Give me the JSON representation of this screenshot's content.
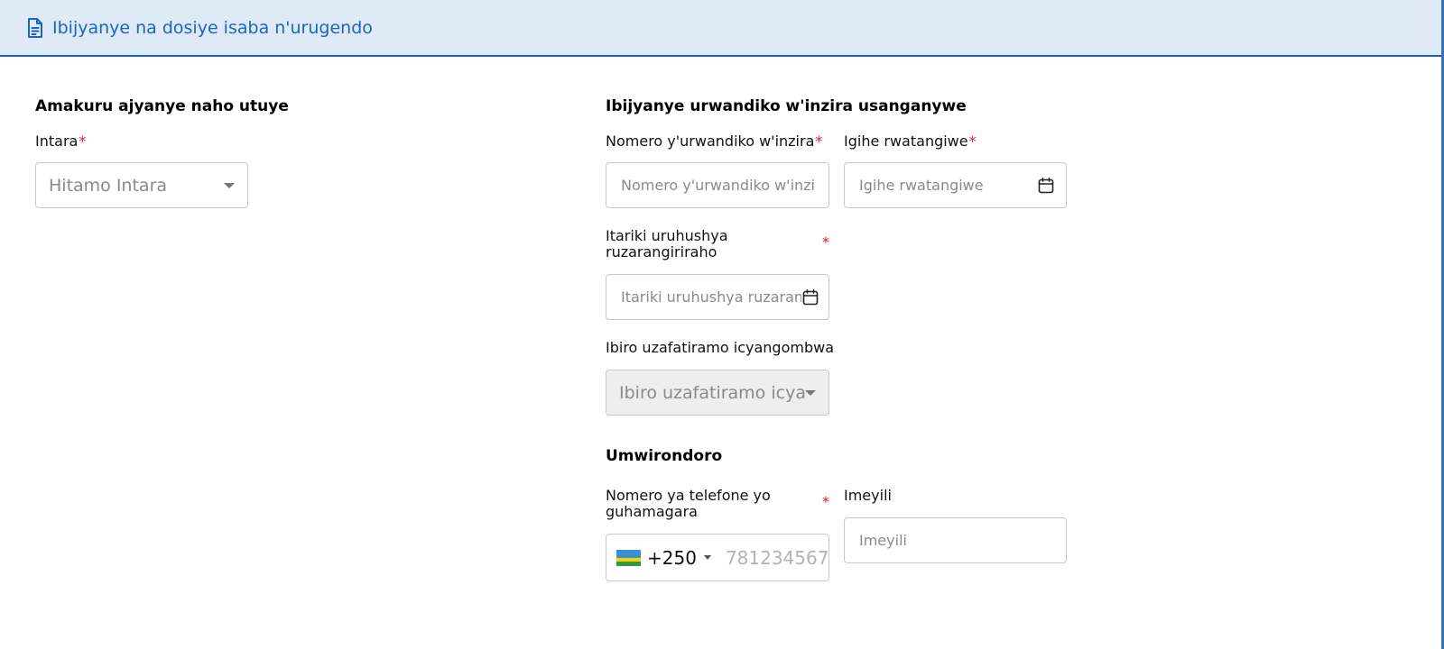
{
  "header": {
    "title": "Ibijyanye na dosiye isaba n'urugendo",
    "icon": "document-icon"
  },
  "left_section": {
    "title": "Amakuru ajyanye naho utuye",
    "province": {
      "label": "Intara",
      "required_mark": "*",
      "placeholder": "Hitamo Intara"
    }
  },
  "right_section": {
    "title": "Ibijyanye urwandiko w'inzira usanganywe",
    "passport_number": {
      "label": "Nomero y'urwandiko w'inzira",
      "required_mark": "*",
      "placeholder": "Nomero y'urwandiko w'inzira"
    },
    "issue_date": {
      "label": "Igihe rwatangiwe",
      "required_mark": "*",
      "placeholder": "Igihe rwatangiwe"
    },
    "expiry_date": {
      "label": "Itariki uruhushya ruzarangiriraho",
      "required_mark": "*",
      "placeholder": "Itariki uruhushya ruzarangiriraho"
    },
    "pickup_office": {
      "label": "Ibiro uzafatiramo icyangombwa",
      "placeholder": "Ibiro uzafatiramo icyangombwa"
    }
  },
  "contact_section": {
    "title": "Umwirondoro",
    "phone": {
      "label": "Nomero ya telefone yo guhamagara",
      "required_mark": "*",
      "dial_code": "+250",
      "placeholder": "781234567",
      "flag": "rwanda-flag"
    },
    "email": {
      "label": "Imeyili",
      "placeholder": "Imeyili"
    }
  },
  "colors": {
    "accent": "#1d63c4",
    "header_bg": "#dfeaf7",
    "required": "#e0182d"
  }
}
